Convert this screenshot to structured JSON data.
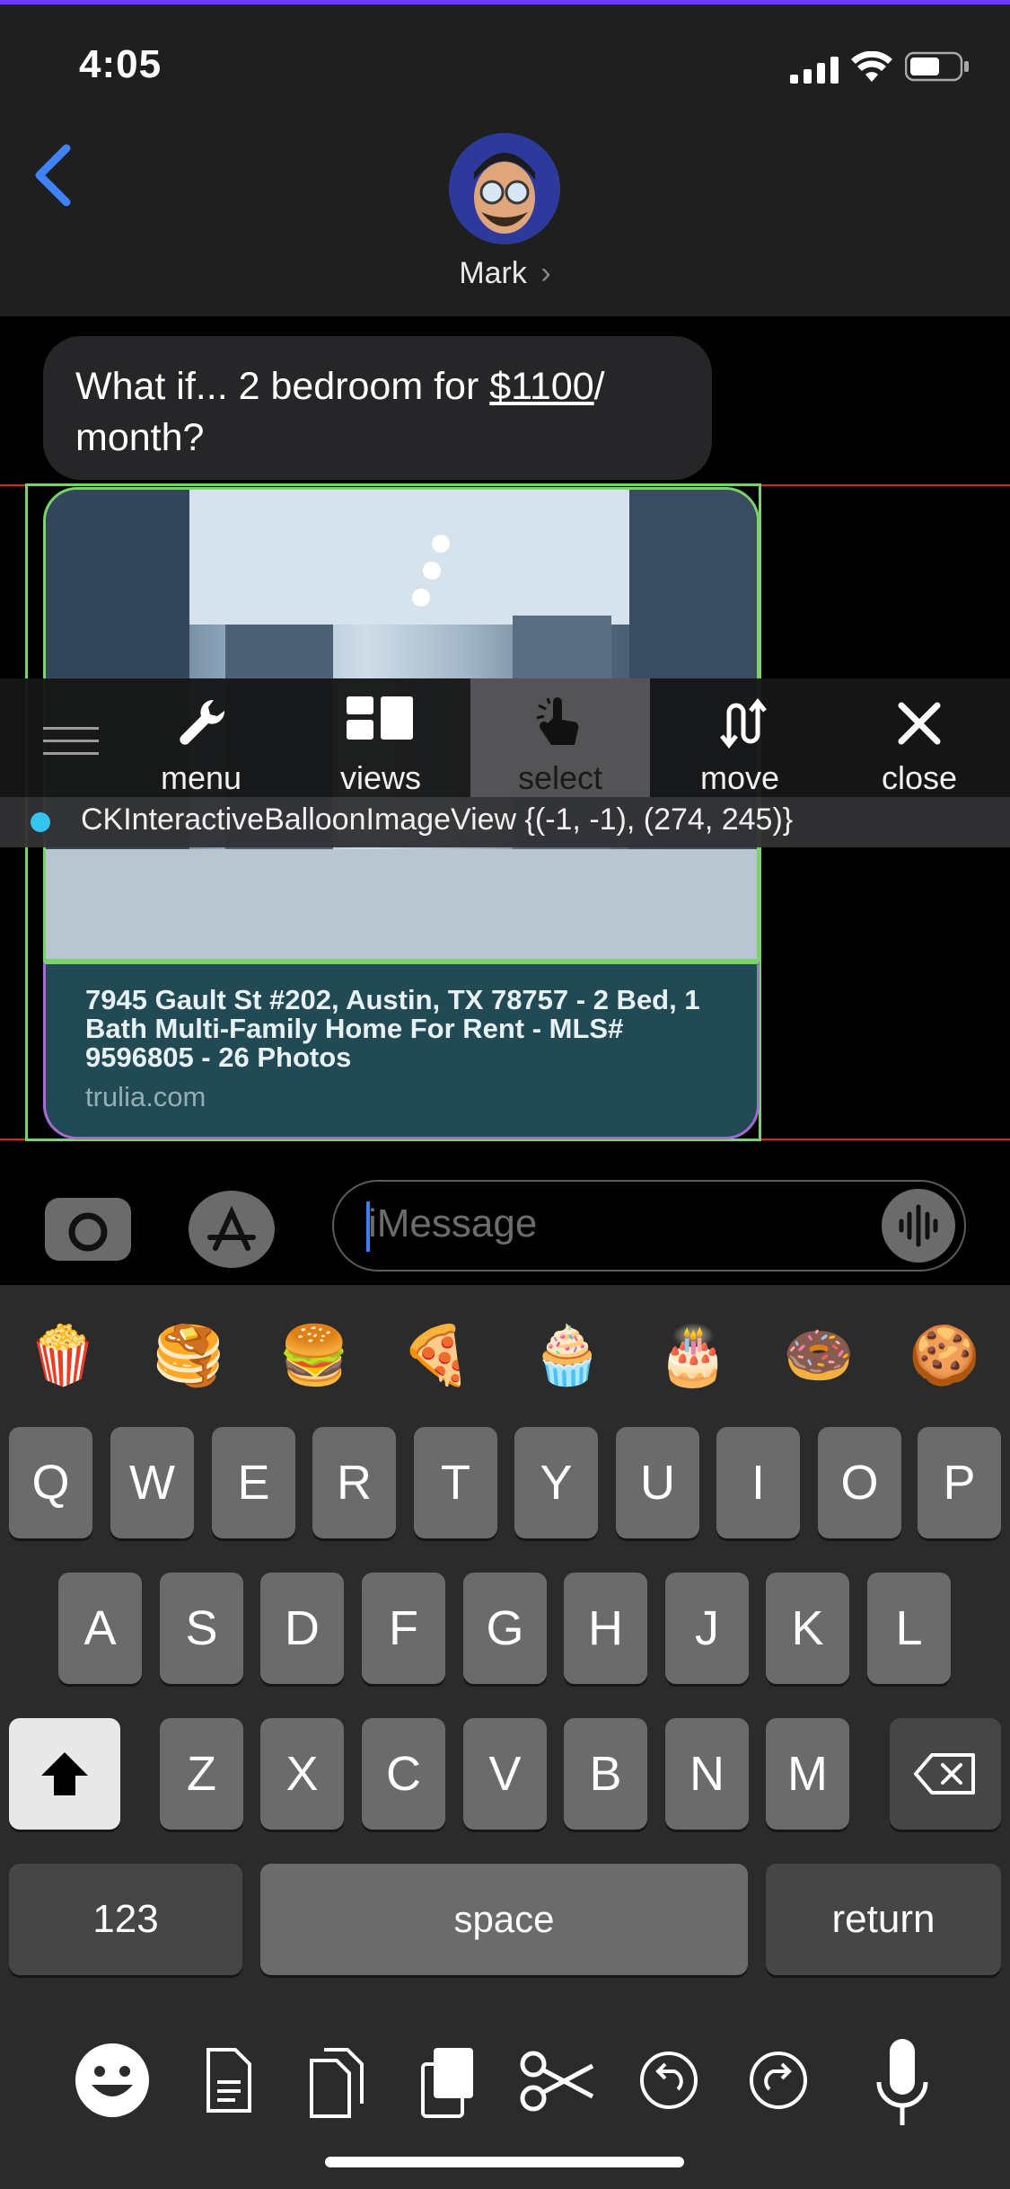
{
  "status_bar": {
    "time": "4:05"
  },
  "header": {
    "contact_name": "Mark",
    "chevron": "›"
  },
  "message": {
    "text_before": "What if... 2 bedroom for ",
    "price_link": "$1100",
    "text_after": "/ month?"
  },
  "link_preview": {
    "title": "7945 Gault St #202, Austin, TX 78757 - 2 Bed, 1 Bath Multi-Family Home For Rent - MLS# 9596805 - 26 Photos",
    "domain": "trulia.com"
  },
  "debug_toolbar": {
    "items": [
      {
        "label": "menu",
        "icon": "wrench-icon"
      },
      {
        "label": "views",
        "icon": "views-icon"
      },
      {
        "label": "select",
        "icon": "tap-icon",
        "selected": true
      },
      {
        "label": "move",
        "icon": "move-arrows-icon"
      },
      {
        "label": "close",
        "icon": "close-icon"
      }
    ],
    "status_text": "CKInteractiveBalloonImageView {(-1, -1), (274, 245)}",
    "accent": "#35c3ef"
  },
  "input": {
    "placeholder": "iMessage"
  },
  "emoji_row": [
    "🍿",
    "🥞",
    "🍔",
    "🍕",
    "🧁",
    "🎂",
    "🍩",
    "🍪"
  ],
  "keyboard": {
    "row1": [
      "Q",
      "W",
      "E",
      "R",
      "T",
      "Y",
      "U",
      "I",
      "O",
      "P"
    ],
    "row2": [
      "A",
      "S",
      "D",
      "F",
      "G",
      "H",
      "J",
      "K",
      "L"
    ],
    "row3": [
      "Z",
      "X",
      "C",
      "V",
      "B",
      "N",
      "M"
    ],
    "numbers_label": "123",
    "space_label": "space",
    "return_label": "return"
  },
  "colors": {
    "back_button": "#3f82f7",
    "guide_line": "#d62a2a",
    "selection_outline": "#7ad46a"
  }
}
